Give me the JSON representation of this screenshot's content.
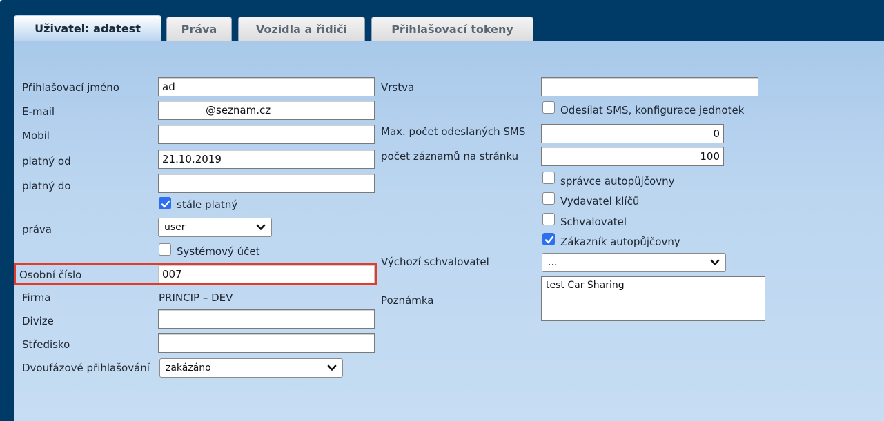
{
  "tabs": [
    {
      "label": "Uživatel: adatest",
      "active": true
    },
    {
      "label": "Práva",
      "active": false
    },
    {
      "label": "Vozidla a řidiči",
      "active": false
    },
    {
      "label": "Přihlašovací tokeny",
      "active": false
    }
  ],
  "left": {
    "login_label": "Přihlašovací jméno",
    "login_value": "ad",
    "email_label": "E-mail",
    "email_value": "@seznam.cz",
    "mobile_label": "Mobil",
    "mobile_value": "",
    "valid_from_label": "platný od",
    "valid_from_value": "21.10.2019",
    "valid_to_label": "platný do",
    "valid_to_value": "",
    "always_valid_label": "stále platný",
    "always_valid_checked": true,
    "rights_label": "práva",
    "rights_value": "user",
    "system_account_label": "Systémový účet",
    "system_account_checked": false,
    "personal_number_label": "Osobní číslo",
    "personal_number_value": "007",
    "company_label": "Firma",
    "company_value": "PRINCIP – DEV",
    "division_label": "Divize",
    "division_value": "",
    "center_label": "Středisko",
    "center_value": "",
    "two_factor_label": "Dvoufázové přihlašování",
    "two_factor_value": "zakázáno"
  },
  "right": {
    "layer_label": "Vrstva",
    "layer_value": "",
    "send_sms_label": "Odesílat SMS, konfigurace jednotek",
    "send_sms_checked": false,
    "max_sms_label": "Max. počet odeslaných SMS",
    "max_sms_value": "0",
    "records_label": "počet záznamů na stránku",
    "records_value": "100",
    "rental_admin_label": "správce autopůjčovny",
    "rental_admin_checked": false,
    "key_issuer_label": "Vydavatel klíčů",
    "key_issuer_checked": false,
    "approver_label": "Schvalovatel",
    "approver_checked": false,
    "rental_customer_label": "Zákazník autopůjčovny",
    "rental_customer_checked": true,
    "default_approver_label": "Výchozí schvalovatel",
    "default_approver_value": "...",
    "note_label": "Poznámka",
    "note_value": "test Car Sharing"
  },
  "colors": {
    "frame": "#003a66",
    "panel": "#bcd6f0",
    "checkbox_on": "#2e6ff0",
    "highlight": "#e23b2b"
  }
}
